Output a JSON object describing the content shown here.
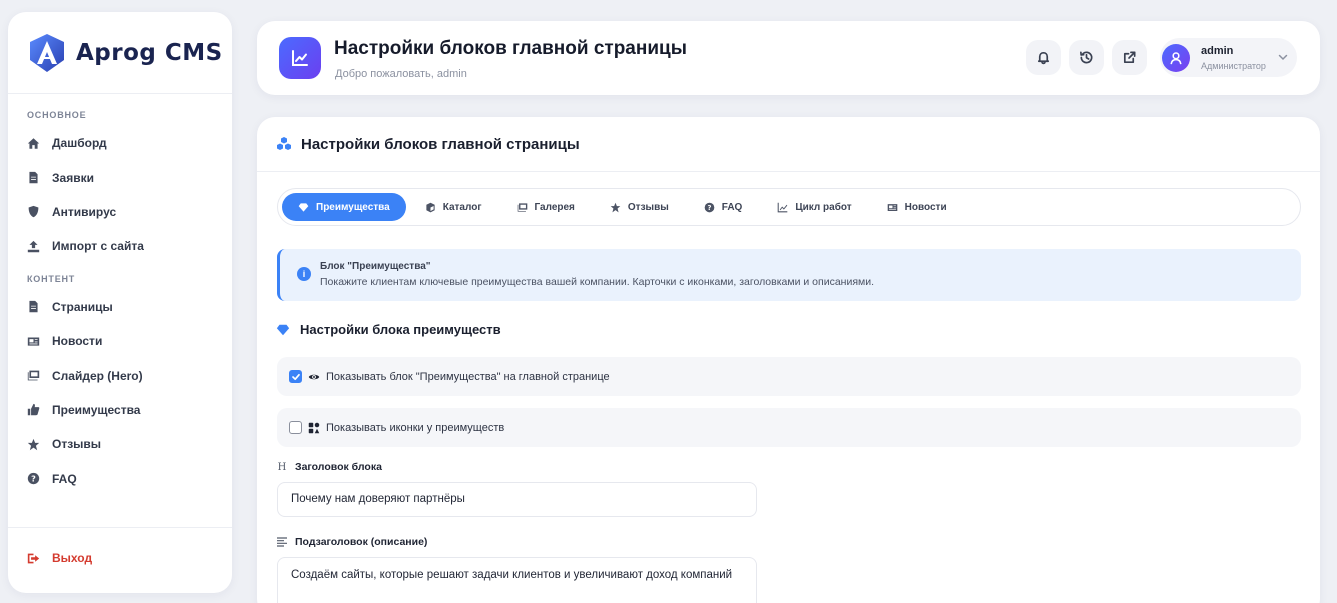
{
  "brand": {
    "name": "Aprog CMS"
  },
  "sidebar": {
    "section_main": "Основное",
    "main_items": [
      {
        "label": "Дашборд",
        "icon": "home-icon"
      },
      {
        "label": "Заявки",
        "icon": "file-icon"
      },
      {
        "label": "Антивирус",
        "icon": "shield-icon"
      },
      {
        "label": "Импорт с сайта",
        "icon": "upload-icon"
      }
    ],
    "section_content": "Контент",
    "content_items": [
      {
        "label": "Страницы",
        "icon": "file-icon"
      },
      {
        "label": "Новости",
        "icon": "newspaper-icon"
      },
      {
        "label": "Слайдер (Hero)",
        "icon": "images-icon"
      },
      {
        "label": "Преимущества",
        "icon": "thumbs-up-icon"
      },
      {
        "label": "Отзывы",
        "icon": "star-icon"
      },
      {
        "label": "FAQ",
        "icon": "question-icon"
      }
    ],
    "logout": "Выход"
  },
  "header": {
    "title": "Настройки блоков главной страницы",
    "subtitle": "Добро пожаловать, admin",
    "user": {
      "name": "admin",
      "role": "Администратор"
    }
  },
  "card": {
    "title": "Настройки блоков главной страницы",
    "tabs": [
      {
        "label": "Преимущества",
        "active": true
      },
      {
        "label": "Каталог"
      },
      {
        "label": "Галерея"
      },
      {
        "label": "Отзывы"
      },
      {
        "label": "FAQ"
      },
      {
        "label": "Цикл работ"
      },
      {
        "label": "Новости"
      }
    ],
    "alert": {
      "title": "Блок \"Преимущества\"",
      "text": "Покажите клиентам ключевые преимущества вашей компании. Карточки с иконками, заголовками и описаниями."
    },
    "section_title": "Настройки блока преимуществ",
    "show_block": {
      "label": "Показывать блок \"Преимущества\" на главной странице",
      "checked": true
    },
    "show_icons": {
      "label": "Показывать иконки у преимуществ",
      "checked": false
    },
    "heading_label": "Заголовок блока",
    "heading_value": "Почему нам доверяют партнёры",
    "subheading_label": "Подзаголовок (описание)",
    "subheading_value": "Создаём сайты, которые решают задачи клиентов и увеличивают доход компаний"
  },
  "colors": {
    "accent": "#3b82f6",
    "logout": "#d43b2f",
    "brand_gradient": [
      "#4b6bff",
      "#6b3ff0"
    ]
  }
}
